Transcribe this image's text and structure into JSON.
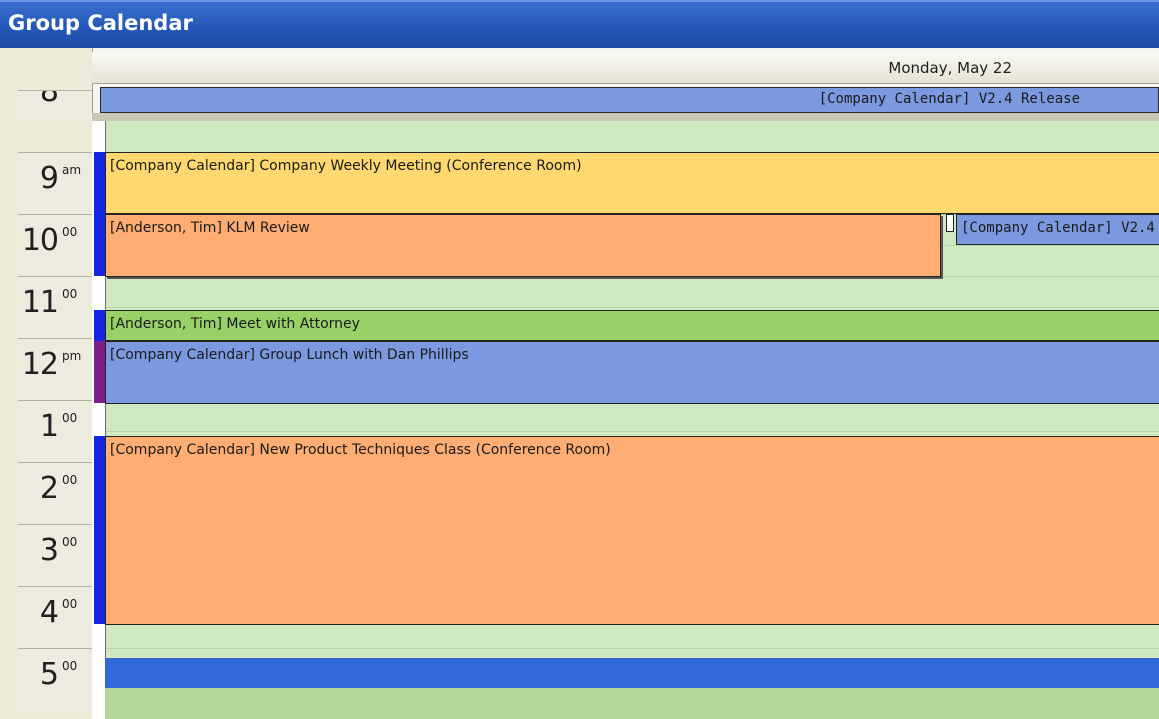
{
  "window": {
    "title": "Group Calendar"
  },
  "day_header": {
    "label": "Monday, May 22"
  },
  "all_day_event": {
    "label": "[Company Calendar] V2.4 Release"
  },
  "time_slots": [
    {
      "hour": "8",
      "suffix": ""
    },
    {
      "hour": "9",
      "suffix": "am"
    },
    {
      "hour": "10",
      "suffix": "00"
    },
    {
      "hour": "11",
      "suffix": "00"
    },
    {
      "hour": "12",
      "suffix": "pm"
    },
    {
      "hour": "1",
      "suffix": "00"
    },
    {
      "hour": "2",
      "suffix": "00"
    },
    {
      "hour": "3",
      "suffix": "00"
    },
    {
      "hour": "4",
      "suffix": "00"
    },
    {
      "hour": "5",
      "suffix": "00"
    }
  ],
  "events": [
    {
      "label": "[Company Calendar] Company Weekly Meeting (Conference Room)",
      "color": "#ffd96f"
    },
    {
      "label": "[Anderson, Tim] KLM Review",
      "color": "#ffad73"
    },
    {
      "label": "[Company Calendar] V2.4",
      "color": "#7b99df"
    },
    {
      "label": "[Anderson, Tim] Meet with Attorney",
      "color": "#97d167"
    },
    {
      "label": "[Company Calendar] Group Lunch with Dan Phillips",
      "color": "#7b99df"
    },
    {
      "label": "[Company Calendar] New Product Techniques Class (Conference Room)",
      "color": "#ffad73"
    },
    {
      "label": "",
      "color": "#2f6ad6"
    }
  ],
  "colors": {
    "titlebar": "#2457b8",
    "free_time": "#d1e9c1",
    "busy_bar": "#1726e3",
    "tentative_bar": "#7b1e8a"
  }
}
